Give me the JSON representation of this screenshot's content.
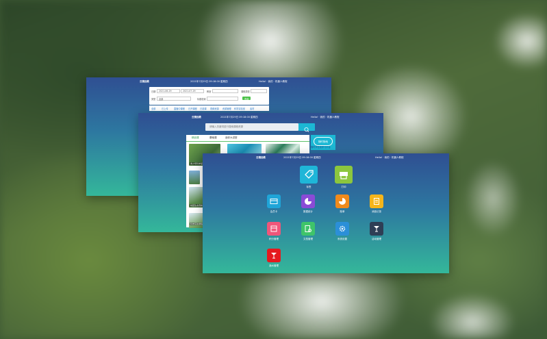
{
  "windows": {
    "w1": {
      "brand": "云镜远教",
      "clock": "2021年7月29日 09:18:00 星期四",
      "user": "Hello! · 我的 · 机器人教程",
      "filter": {
        "row1_a": "日期",
        "row1_b": "2021-06-29",
        "row1_c": "2021-07-29",
        "row1_d": "教室",
        "row1_e": "课程类型",
        "row2_a": "类型",
        "row2_b": "全部",
        "row2_c": "标题检索",
        "query": "查询"
      },
      "tabs": [
        "全部",
        "已上传",
        "直播中课程",
        "已开课程",
        "已选课",
        "视频资源",
        "资源管理",
        "科学实验室",
        "素材"
      ]
    },
    "w2": {
      "brand": "云镜远教",
      "clock": "2021年7月29日 09:18:00 星期四",
      "user": "Hello! · 我的 · 机器人教程",
      "search_placeholder": "请输入关键词进行搜索课程资源",
      "tabs": [
        "精品课",
        "基础课",
        "迷你大讲堂"
      ],
      "badge_circle": "随时随地",
      "badge_sub": "随时学在线学习平台",
      "captions": [
        "青少年科学探索",
        "校园生态观察",
        "科学实验课程"
      ]
    },
    "w3": {
      "brand": "云镜远教",
      "clock": "2021年7月29日 09:18:00 星期四",
      "user": "Hello! · 我的 · 机器人教程",
      "apps": [
        {
          "label": "标签",
          "color": "#1fb6d8",
          "icon": "tag-icon"
        },
        {
          "label": "打印",
          "color": "#8cc63e",
          "icon": "printer-icon"
        },
        {
          "label": "会员卡",
          "color": "#1fa5d8",
          "icon": "card-icon"
        },
        {
          "label": "数据统计",
          "color": "#8a4bd6",
          "icon": "pie-chart-icon"
        },
        {
          "label": "账单",
          "color": "#f08a1c",
          "icon": "pie-chart-icon"
        },
        {
          "label": "消费记录",
          "color": "#f5b51a",
          "icon": "document-icon"
        },
        {
          "label": "积分管理",
          "color": "#f0567a",
          "icon": "list-icon"
        },
        {
          "label": "文档管理",
          "color": "#3fc46a",
          "icon": "document-settings-icon"
        },
        {
          "label": "系统设置",
          "color": "#2b8fd8",
          "icon": "gear-icon"
        },
        {
          "label": "活动管理",
          "color": "#2e3e55",
          "icon": "cocktail-icon"
        },
        {
          "label": "酒水管理",
          "color": "#e5191e",
          "icon": "cocktail-icon"
        }
      ]
    }
  }
}
